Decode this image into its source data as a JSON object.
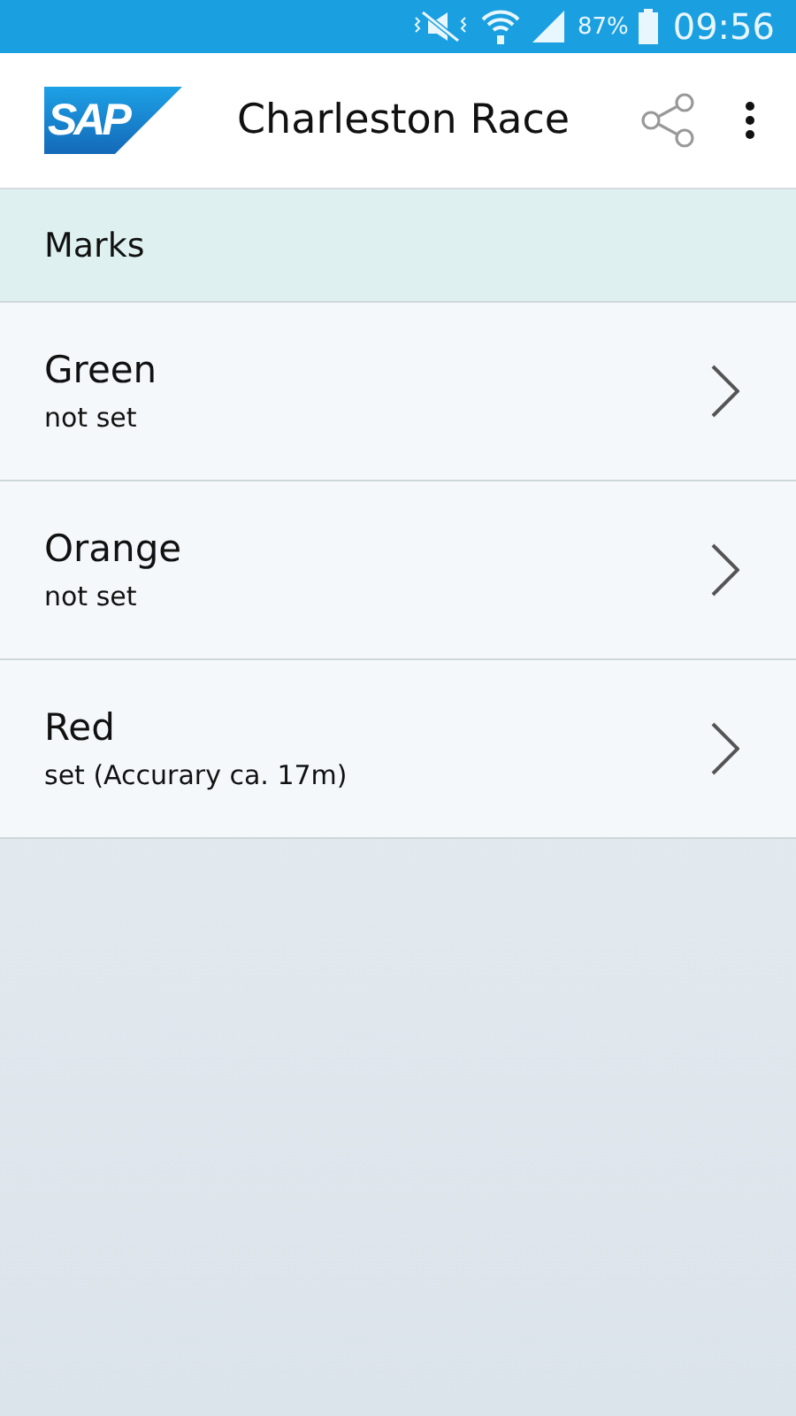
{
  "status_bar": {
    "battery": "87%",
    "time": "09:56"
  },
  "app_bar": {
    "logo": "SAP",
    "title": "Charleston Race"
  },
  "section": {
    "title": "Marks"
  },
  "marks": [
    {
      "name": "Green",
      "status": "not set"
    },
    {
      "name": "Orange",
      "status": "not set"
    },
    {
      "name": "Red",
      "status": "set (Accurary ca. 17m)"
    }
  ]
}
